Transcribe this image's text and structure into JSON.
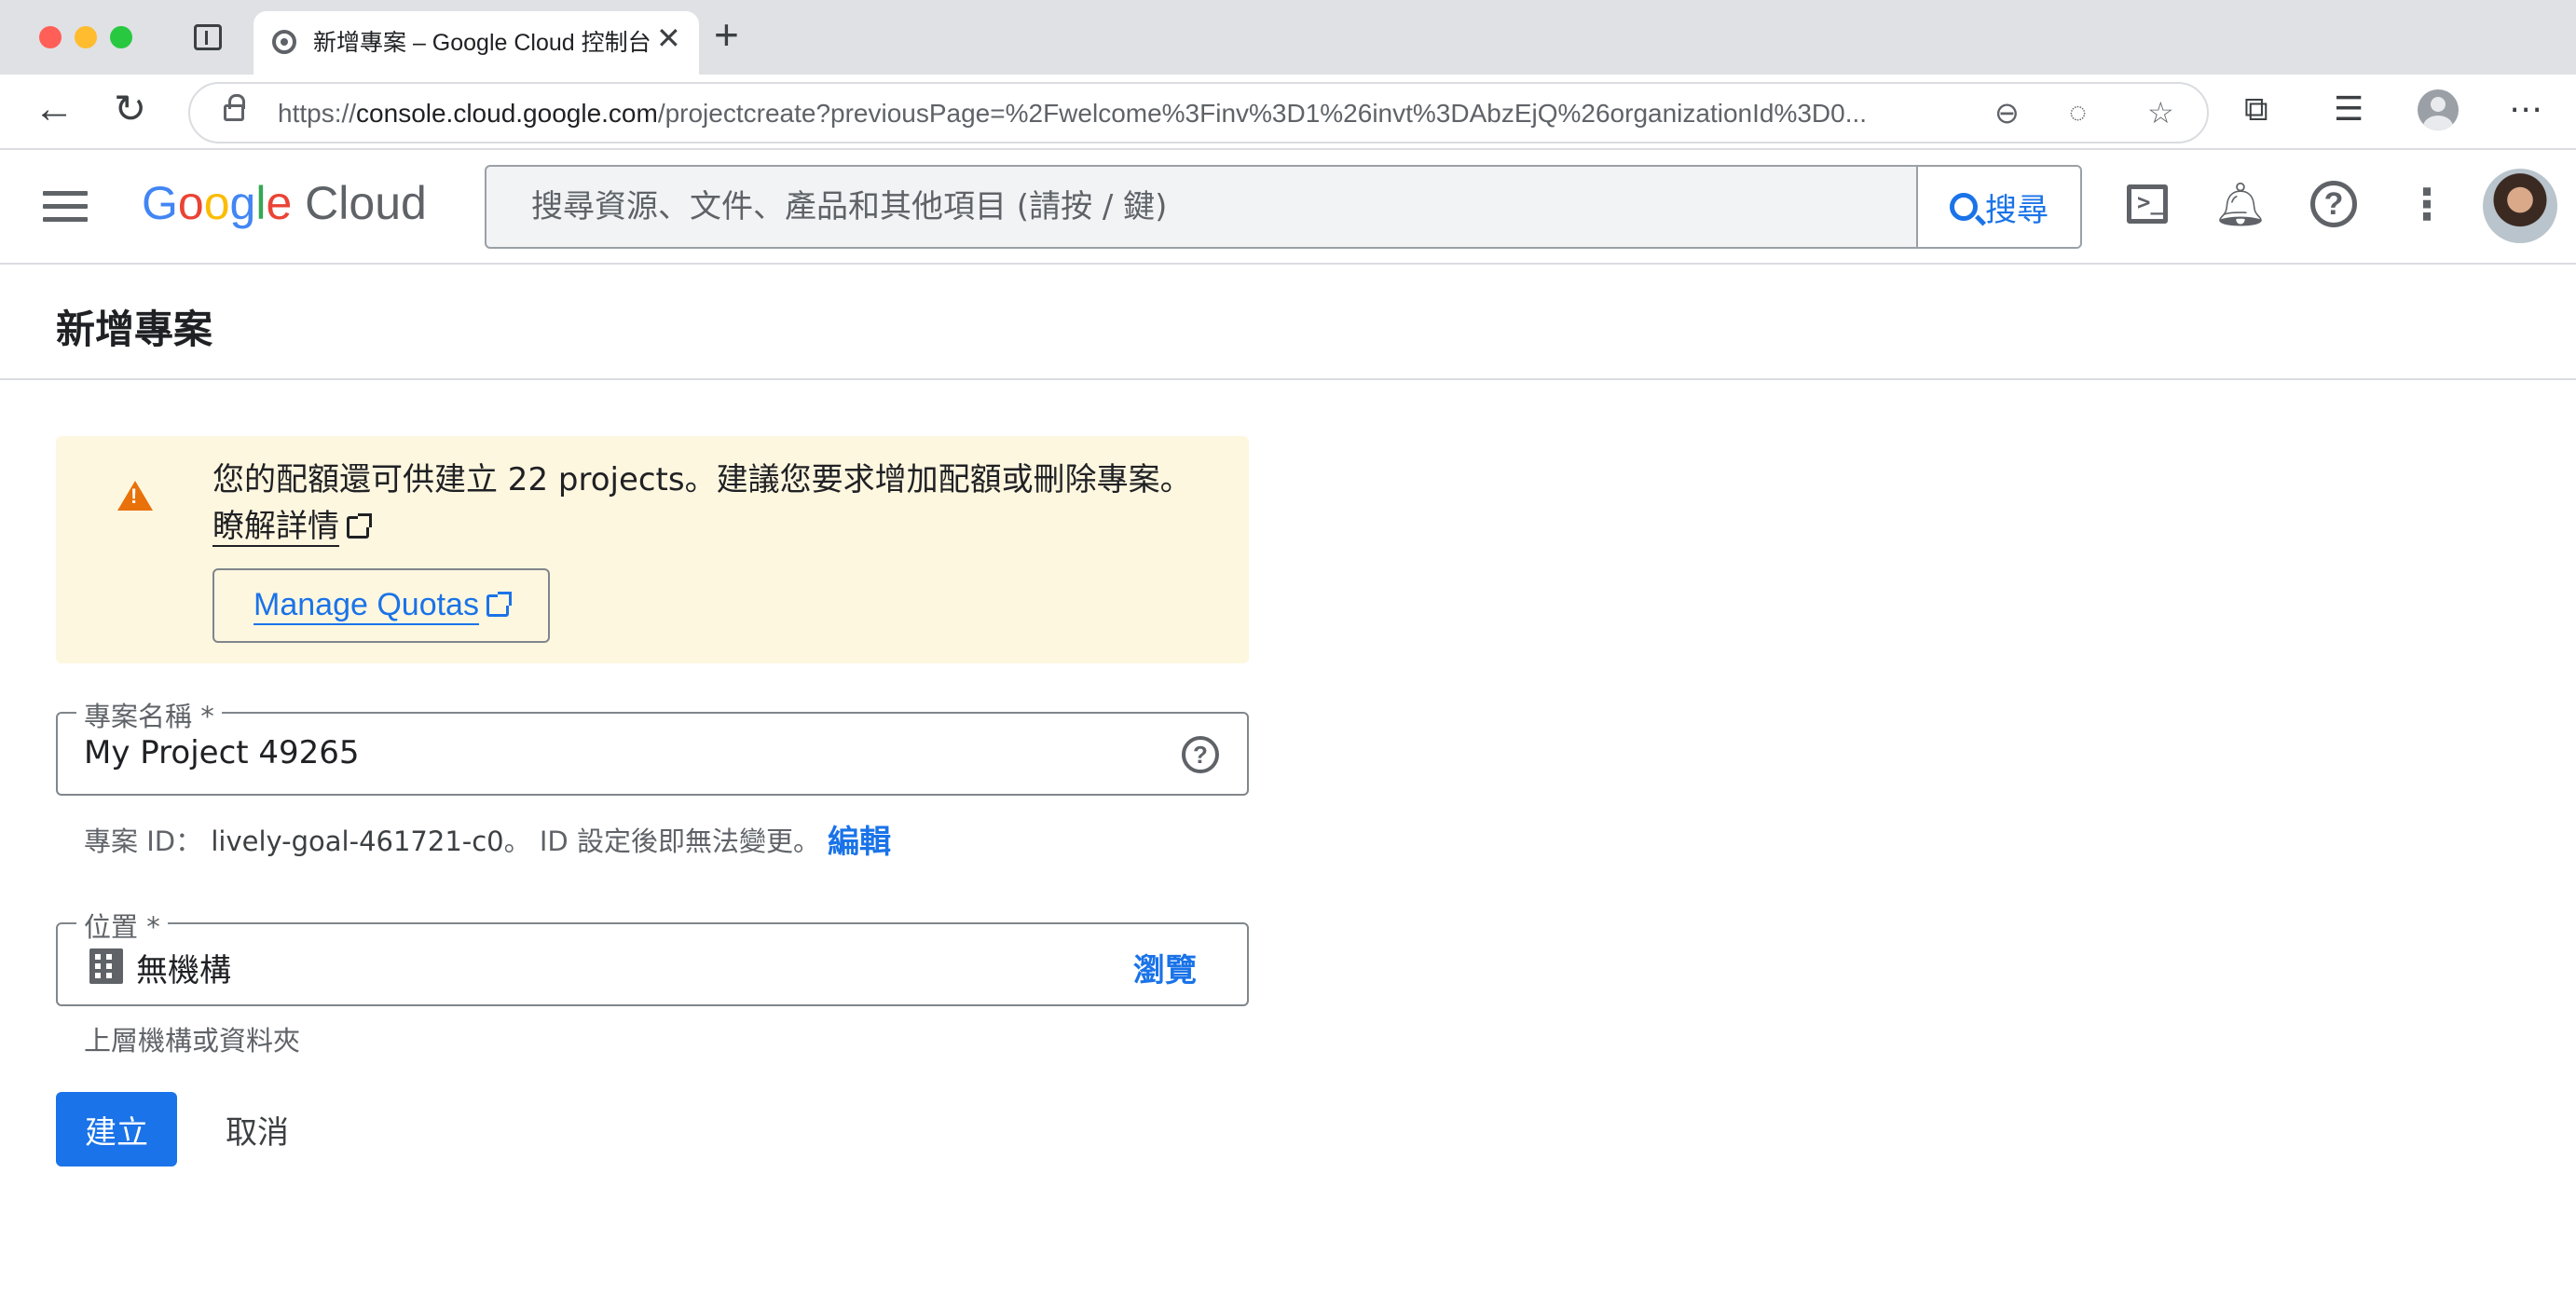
{
  "browser": {
    "tab_title": "新增專案 – Google Cloud 控制台",
    "tab_close": "✕",
    "new_tab": "+",
    "url_prefix": "https://",
    "url_host": "console.cloud.google.com",
    "url_rest": "/projectcreate?previousPage=%2Fwelcome%3Finv%3D1%26invt%3DAbzEjQ%26organizationId%3D0...",
    "icons": [
      "back-arrow-icon",
      "reload-icon",
      "lock-icon",
      "zoom-out-icon",
      "tracking-prevention-icon",
      "favorite-star-icon",
      "extensions-icon",
      "favorites-icon",
      "profile-icon",
      "more-icon"
    ]
  },
  "header": {
    "logo_word": [
      "G",
      "o",
      "o",
      "g",
      "l",
      "e"
    ],
    "logo_suffix": "Cloud",
    "search_placeholder": "搜尋資源、文件、產品和其他項目 (請按 / 鍵)",
    "search_button_label": "搜尋",
    "logo_colors": [
      "#4285f4",
      "#ea4335",
      "#fbbc04",
      "#4285f4",
      "#34a853",
      "#ea4335"
    ]
  },
  "page": {
    "title": "新增專案"
  },
  "warning": {
    "message": "您的配額還可供建立 22 projects。建議您要求增加配額或刪除專案。",
    "learn_more": "瞭解詳情",
    "manage_quotas_label": "Manage Quotas",
    "color": "#fef7e0"
  },
  "project_name": {
    "label": "專案名稱 *",
    "value": "My Project 49265",
    "help": "?"
  },
  "project_id": {
    "prefix": "專案 ID：",
    "value": "lively-goal-461721-c0",
    "suffix": "。 ID 設定後即無法變更。",
    "edit_label": "編輯"
  },
  "location": {
    "label": "位置 *",
    "value": "無機構",
    "browse_label": "瀏覽",
    "hint": "上層機構或資料夾"
  },
  "actions": {
    "create_label": "建立",
    "cancel_label": "取消",
    "primary_color": "#1a73e8"
  }
}
